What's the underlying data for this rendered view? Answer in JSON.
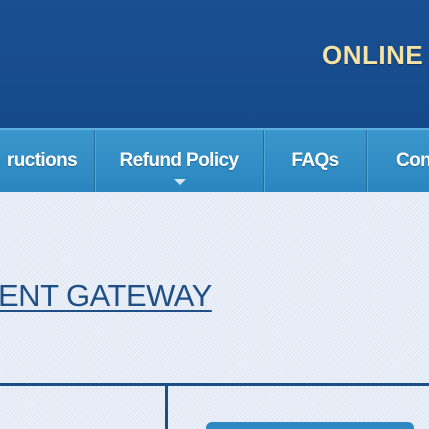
{
  "header": {
    "title": "ONLINE"
  },
  "nav": {
    "items": [
      {
        "label": "ructions"
      },
      {
        "label": "Refund Policy"
      },
      {
        "label": "FAQs"
      },
      {
        "label": "Cont"
      }
    ],
    "active_index": 1
  },
  "main": {
    "heading": "ENT GATEWAY"
  },
  "colors": {
    "header_bg": "#1a4f93",
    "title_text": "#f3e2a3",
    "nav_bg": "#3a97cd",
    "heading_text": "#1f4f86",
    "content_bg": "#e8eef7"
  }
}
